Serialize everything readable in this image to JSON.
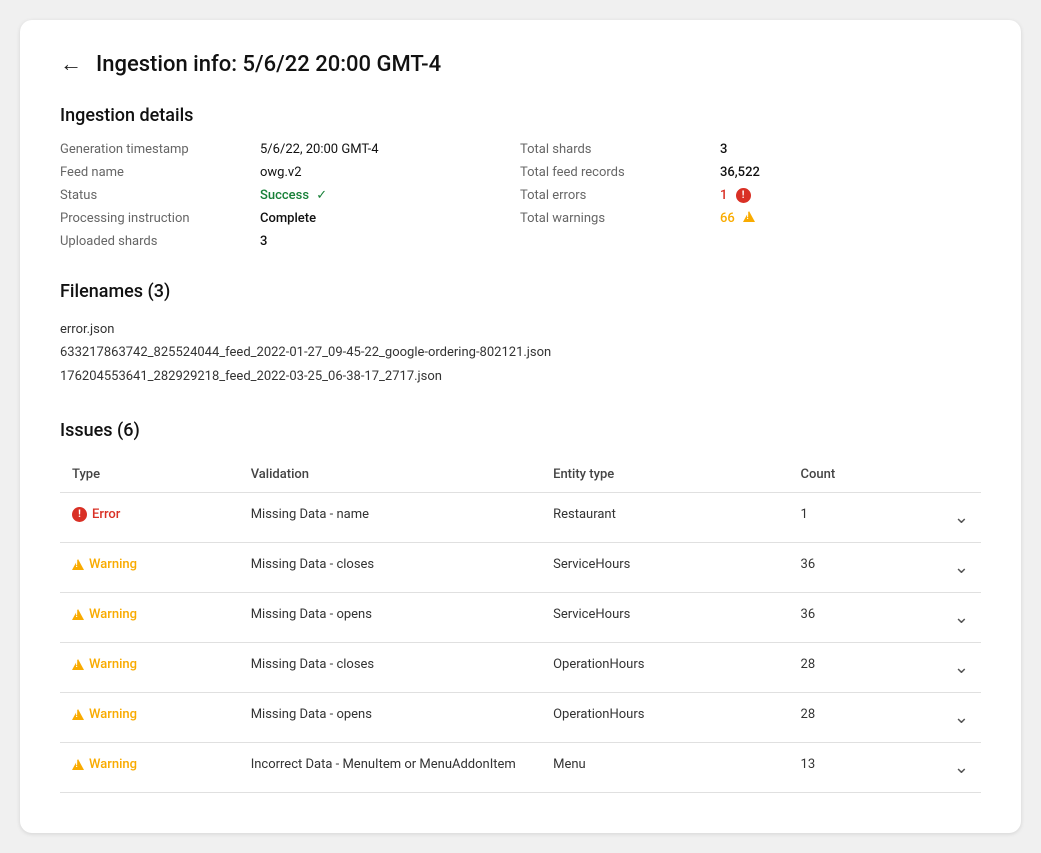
{
  "page": {
    "title": "Ingestion info: 5/6/22 20:00 GMT-4"
  },
  "details": {
    "section_title": "Ingestion details",
    "generation_timestamp_label": "Generation timestamp",
    "generation_timestamp_value": "5/6/22, 20:00 GMT-4",
    "feed_name_label": "Feed name",
    "feed_name_value": "owg.v2",
    "status_label": "Status",
    "status_value": "Success",
    "processing_instruction_label": "Processing instruction",
    "processing_instruction_value": "Complete",
    "uploaded_shards_label": "Uploaded shards",
    "uploaded_shards_value": "3",
    "total_shards_label": "Total shards",
    "total_shards_value": "3",
    "total_feed_records_label": "Total feed records",
    "total_feed_records_value": "36,522",
    "total_errors_label": "Total errors",
    "total_errors_value": "1",
    "total_warnings_label": "Total warnings",
    "total_warnings_value": "66"
  },
  "filenames": {
    "section_title": "Filenames (3)",
    "files": [
      "error.json",
      "633217863742_825524044_feed_2022-01-27_09-45-22_google-ordering-802121.json",
      "176204553641_282929218_feed_2022-03-25_06-38-17_2717.json"
    ]
  },
  "issues": {
    "section_title": "Issues (6)",
    "columns": [
      "Type",
      "Validation",
      "Entity type",
      "Count"
    ],
    "rows": [
      {
        "type": "Error",
        "type_kind": "error",
        "validation": "Missing Data - name",
        "entity_type": "Restaurant",
        "count": "1"
      },
      {
        "type": "Warning",
        "type_kind": "warning",
        "validation": "Missing Data - closes",
        "entity_type": "ServiceHours",
        "count": "36"
      },
      {
        "type": "Warning",
        "type_kind": "warning",
        "validation": "Missing Data - opens",
        "entity_type": "ServiceHours",
        "count": "36"
      },
      {
        "type": "Warning",
        "type_kind": "warning",
        "validation": "Missing Data - closes",
        "entity_type": "OperationHours",
        "count": "28"
      },
      {
        "type": "Warning",
        "type_kind": "warning",
        "validation": "Missing Data - opens",
        "entity_type": "OperationHours",
        "count": "28"
      },
      {
        "type": "Warning",
        "type_kind": "warning",
        "validation": "Incorrect Data - MenuItem or MenuAddonItem",
        "entity_type": "Menu",
        "count": "13"
      }
    ]
  }
}
